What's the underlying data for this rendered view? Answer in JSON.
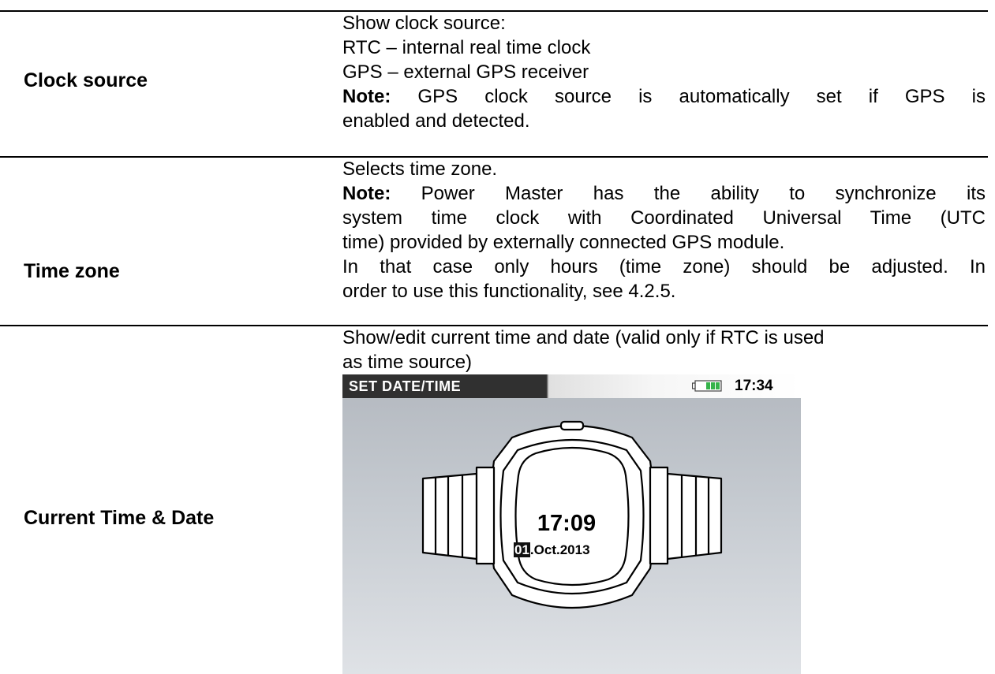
{
  "rows": [
    {
      "term": "Clock source",
      "lines": [
        "Show clock source:",
        "RTC – internal real time clock",
        "GPS – external GPS receiver"
      ],
      "note_label": "Note:",
      "note_line1": " GPS clock source is automatically set if GPS is",
      "note_line2": "enabled and detected."
    },
    {
      "term": "Time zone",
      "line1": "Selects time zone.",
      "note_label": "Note:",
      "note_line1": " Power Master has the ability to synchronize its",
      "note_line2": "system time clock with Coordinated Universal Time (UTC",
      "note_line3": "time) provided by externally connected GPS module.",
      "line_a": "In that case only hours (time zone) should be adjusted. In",
      "line_b": "order to use this functionality, see 4.2.5."
    },
    {
      "term": "Current Time & Date",
      "line1": "Show/edit current time and date (valid only if RTC is used",
      "line2": "as time source)"
    }
  ],
  "screen": {
    "title": "SET DATE/TIME",
    "header_time": "17:34",
    "battery_icon": "battery-icon",
    "watch_icon": "wristwatch-icon",
    "watch_time": "17:09",
    "date_day": "01",
    "date_rest": ".Oct.2013"
  }
}
